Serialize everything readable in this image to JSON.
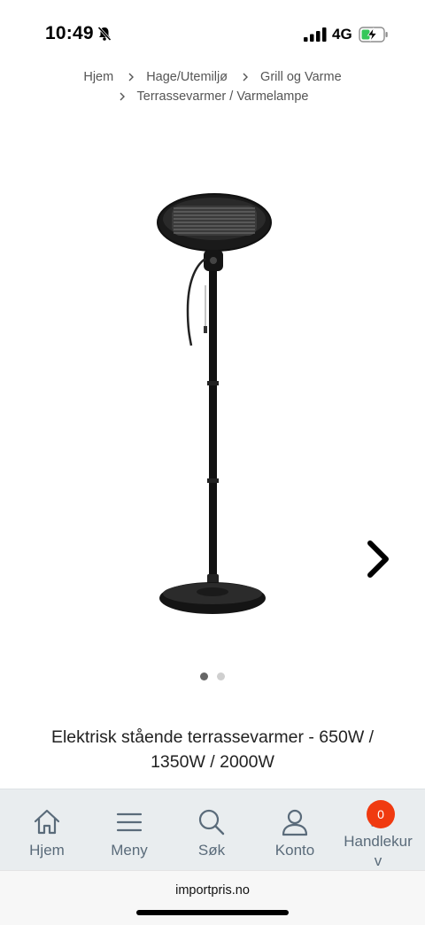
{
  "status_bar": {
    "time": "10:49",
    "network": "4G",
    "icons": [
      "bell-slash-icon",
      "signal-icon",
      "battery-charging-icon"
    ],
    "battery_color": "#34c759"
  },
  "breadcrumb": {
    "items": [
      "Hjem",
      "Hage/Utemiljø",
      "Grill og Varme",
      "Terrassevarmer / Varmelampe"
    ]
  },
  "gallery": {
    "image": "standing-patio-heater",
    "slide_count": 2,
    "active_slide": 1
  },
  "product": {
    "title": "Elektrisk stående terrassevarmer - 650W / 1350W / 2000W"
  },
  "bottom_nav": {
    "items": [
      {
        "label": "Hjem",
        "icon": "home-icon"
      },
      {
        "label": "Meny",
        "icon": "menu-icon"
      },
      {
        "label": "Søk",
        "icon": "search-icon"
      },
      {
        "label": "Konto",
        "icon": "user-icon"
      },
      {
        "label": "Handlekurv",
        "icon": "cart-icon"
      }
    ],
    "cart_count": "0",
    "badge_color": "#f03a10"
  },
  "browser": {
    "url": "importpris.no"
  }
}
